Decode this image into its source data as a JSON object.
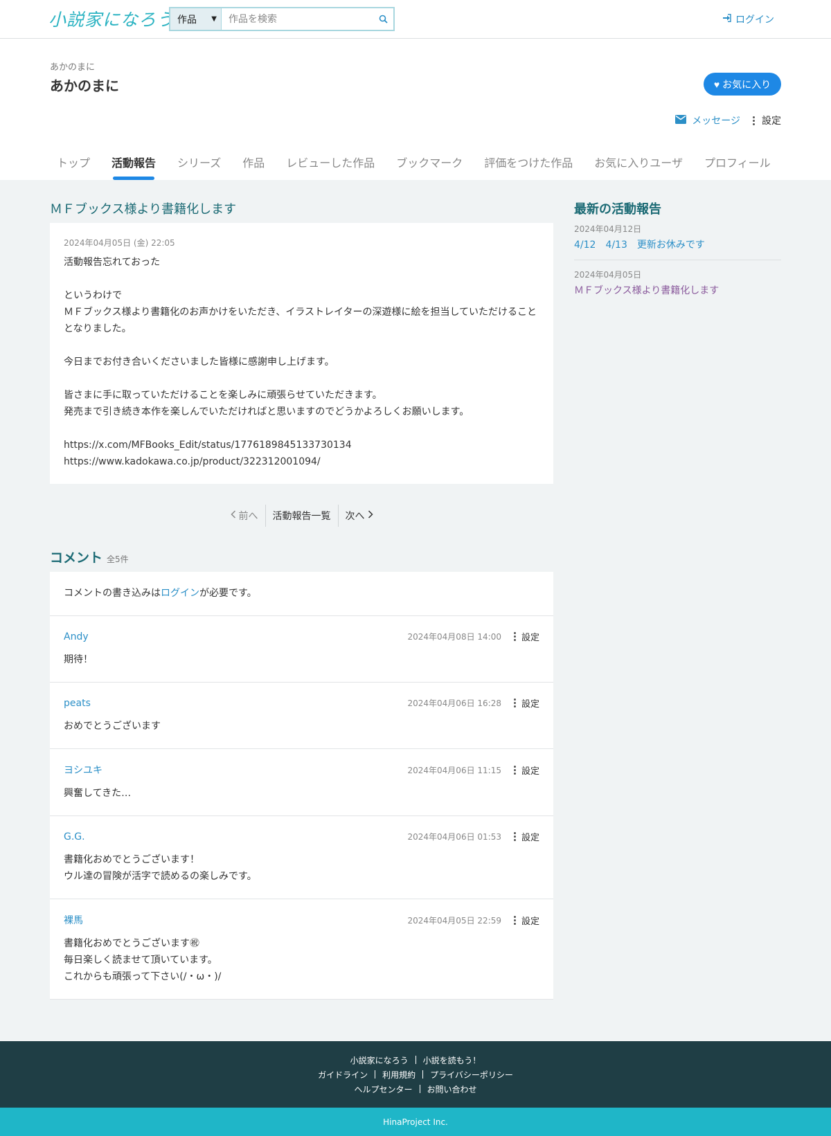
{
  "header": {
    "logo": "小説家になろう",
    "search_category": "作品",
    "search_placeholder": "作品を検索",
    "login_label": "ログイン"
  },
  "user": {
    "kana": "あかのまに",
    "name": "あかのまに",
    "favorite_label": "お気に入り",
    "message_label": "メッセージ",
    "settings_label": "設定"
  },
  "tabs": [
    "トップ",
    "活動報告",
    "シリーズ",
    "作品",
    "レビューした作品",
    "ブックマーク",
    "評価をつけた作品",
    "お気に入りユーザ",
    "プロフィール"
  ],
  "post": {
    "title": "ＭＦブックス様より書籍化します",
    "date": "2024年04月05日 (金) 22:05",
    "lines": [
      "活動報告忘れておった",
      "",
      "というわけで",
      "ＭＦブックス様より書籍化のお声かけをいただき、イラストレイターの深遊様に絵を担当していただけることとなりました。",
      "",
      "今日までお付き合いくださいました皆様に感謝申し上げます。",
      "",
      "皆さまに手に取っていただけることを楽しみに頑張らせていただきます。",
      "発売まで引き続き本作を楽しんでいただければと思いますのでどうかよろしくお願いします。",
      "",
      "https://x.com/MFBooks_Edit/status/1776189845133730134",
      "https://www.kadokawa.co.jp/product/322312001094/"
    ]
  },
  "pager": {
    "prev": "前へ",
    "list": "活動報告一覧",
    "next": "次へ"
  },
  "comments_section": {
    "title": "コメント",
    "count": "全5件",
    "note_before": "コメントの書き込みは",
    "note_link": "ログイン",
    "note_after": "が必要です。",
    "settings_label": "設定"
  },
  "comments": [
    {
      "author": "Andy",
      "date": "2024年04月08日 14:00",
      "lines": [
        "期待！"
      ]
    },
    {
      "author": "peats",
      "date": "2024年04月06日 16:28",
      "lines": [
        "おめでとうございます"
      ]
    },
    {
      "author": "ヨシユキ",
      "date": "2024年04月06日 11:15",
      "lines": [
        "興奮してきた…"
      ]
    },
    {
      "author": "G.G.",
      "date": "2024年04月06日 01:53",
      "lines": [
        "書籍化おめでとうございます！",
        "ウル達の冒険が活字で読めるの楽しみです。"
      ]
    },
    {
      "author": "裸馬",
      "date": "2024年04月05日 22:59",
      "lines": [
        "書籍化おめでとうございます㊗",
        "毎日楽しく読ませて頂いています。",
        "これからも頑張って下さい(/・ω・)/"
      ]
    }
  ],
  "side": {
    "title": "最新の活動報告",
    "items": [
      {
        "date": "2024年04月12日",
        "label": "4/12　4/13　更新お休みです"
      },
      {
        "date": "2024年04月05日",
        "label": "ＭＦブックス様より書籍化します"
      }
    ]
  },
  "footer": {
    "row1": [
      "小説家になろう",
      "小説を読もう！"
    ],
    "row2": [
      "ガイドライン",
      "利用規約",
      "プライバシーポリシー"
    ],
    "row3": [
      "ヘルプセンター",
      "お問い合わせ"
    ],
    "copyright": "HinaProject Inc."
  },
  "colors": {
    "accent": "#1e88e5",
    "link": "#2b8fc7",
    "heading": "#1b6a74",
    "footer_bg": "#1f3e45",
    "copyright_bg": "#1fb6c8"
  }
}
